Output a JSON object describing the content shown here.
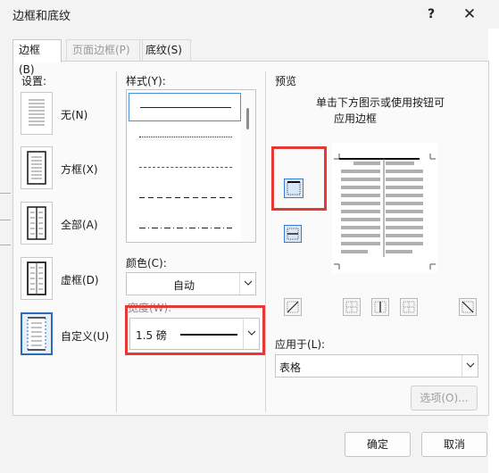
{
  "title": "边框和底纹",
  "titlebar": {
    "help": "?",
    "close": "✕"
  },
  "tabs": [
    {
      "label": "边框(B)",
      "state": "active"
    },
    {
      "label": "页面边框(P)",
      "state": "disabled"
    },
    {
      "label": "底纹(S)",
      "state": "normal"
    }
  ],
  "settings": {
    "heading": "设置:",
    "items": [
      {
        "label": "无(N)",
        "icon": "no-border-icon"
      },
      {
        "label": "方框(X)",
        "icon": "box-border-icon"
      },
      {
        "label": "全部(A)",
        "icon": "all-borders-icon"
      },
      {
        "label": "虚框(D)",
        "icon": "grid-border-icon"
      },
      {
        "label": "自定义(U)",
        "icon": "custom-border-icon",
        "selected": true
      }
    ]
  },
  "style": {
    "heading": "样式(Y):",
    "lines": [
      "solid",
      "dotted-fine",
      "dashed-fine",
      "dashed",
      "dash-dot"
    ]
  },
  "color": {
    "heading": "颜色(C):",
    "value": "自动"
  },
  "width": {
    "heading": "宽度(W):",
    "value": "1.5 磅"
  },
  "preview": {
    "heading": "预览",
    "hint_line1": "单击下方图示或使用按钮可",
    "hint_line2": "应用边框"
  },
  "apply_to": {
    "heading": "应用于(L):",
    "value": "表格"
  },
  "buttons": {
    "options": "选项(O)...",
    "ok": "确定",
    "cancel": "取消"
  },
  "colors": {
    "highlight": "#e53935",
    "selection": "#2d6bb8"
  }
}
